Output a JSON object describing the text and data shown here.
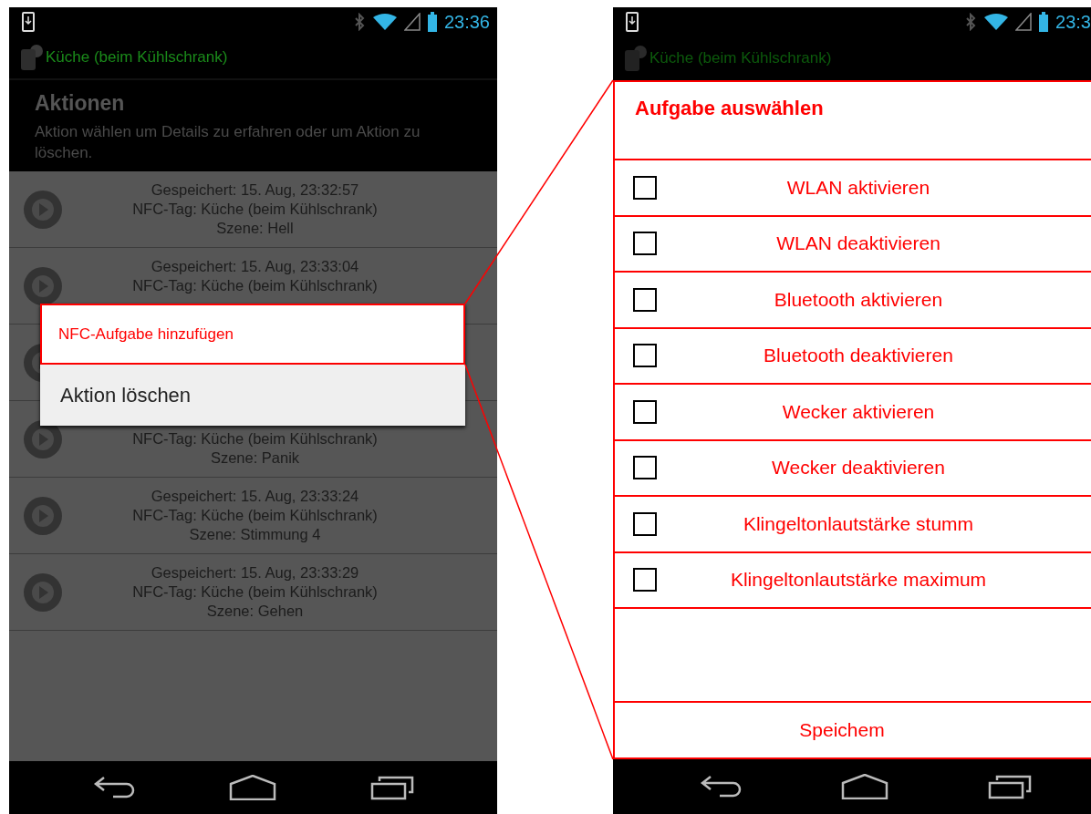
{
  "left_screen": {
    "status_bar": {
      "time": "23:36"
    },
    "title": "Küche (beim Kühlschrank)",
    "header": {
      "title": "Aktionen",
      "subtitle": "Aktion wählen um Details zu erfahren oder um Aktion zu löschen."
    },
    "rows": [
      {
        "kind": "entry",
        "top_covered": false,
        "bottom_covered": false,
        "lines": [
          "Gespeichert: 15. Aug, 23:32:57",
          "NFC-Tag: Küche (beim Kühlschrank)",
          "Szene: Hell"
        ]
      },
      {
        "kind": "entry",
        "top_covered": false,
        "bottom_covered": true,
        "lines": [
          "Gespeichert: 15. Aug, 23:33:04",
          "NFC-Tag: Küche (beim Kühlschrank)"
        ]
      },
      {
        "kind": "covered"
      },
      {
        "kind": "entry",
        "top_covered": true,
        "bottom_covered": false,
        "lines": [
          "NFC-Tag: Küche (beim Kühlschrank)",
          "Szene: Panik"
        ]
      },
      {
        "kind": "entry",
        "top_covered": false,
        "bottom_covered": false,
        "lines": [
          "Gespeichert: 15. Aug, 23:33:24",
          "NFC-Tag: Küche (beim Kühlschrank)",
          "Szene: Stimmung 4"
        ]
      },
      {
        "kind": "entry",
        "top_covered": false,
        "bottom_covered": false,
        "lines": [
          "Gespeichert: 15. Aug, 23:33:29",
          "NFC-Tag: Küche (beim Kühlschrank)",
          "Szene: Gehen"
        ]
      }
    ],
    "context_menu": [
      {
        "label": "NFC-Aufgabe hinzufügen",
        "highlighted": true
      },
      {
        "label": "Aktion löschen",
        "highlighted": false
      }
    ]
  },
  "right_screen": {
    "status_bar": {
      "time": "23:3"
    },
    "title": "Küche (beim Kühlschrank)",
    "dialog": {
      "title": "Aufgabe auswählen",
      "options": [
        {
          "label": "WLAN aktivieren",
          "checked": false
        },
        {
          "label": "WLAN deaktivieren",
          "checked": false
        },
        {
          "label": "Bluetooth aktivieren",
          "checked": false
        },
        {
          "label": "Bluetooth deaktivieren",
          "checked": false
        },
        {
          "label": "Wecker aktivieren",
          "checked": false
        },
        {
          "label": "Wecker deaktivieren",
          "checked": false
        },
        {
          "label": "Klingeltonlautstärke stumm",
          "checked": false
        },
        {
          "label": "Klingeltonlautstärke maximum",
          "checked": false
        }
      ],
      "button": "Speichem"
    }
  }
}
